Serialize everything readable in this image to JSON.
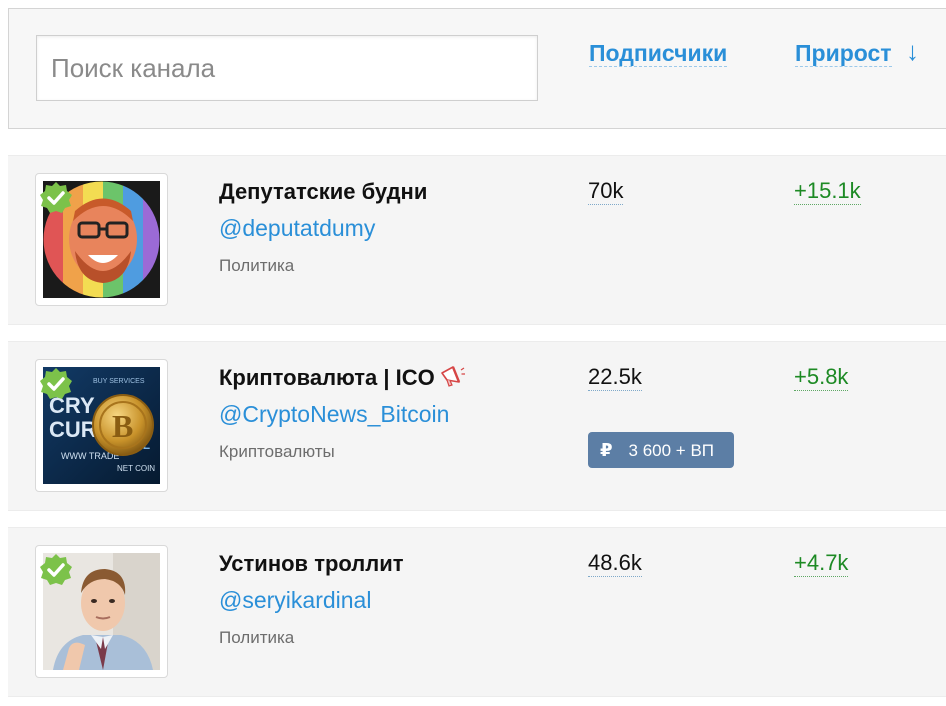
{
  "search": {
    "placeholder": "Поиск канала"
  },
  "columns": {
    "subscribers_label": "Подписчики",
    "growth_label": "Прирост",
    "sort_arrow": "↓"
  },
  "channels": [
    {
      "title": "Депутатские будни",
      "handle": "@deputatdumy",
      "category": "Политика",
      "subscribers": "70k",
      "growth": "+15.1k",
      "verified": true,
      "avatar_icon": "cartoon-portrait-rainbow-avatar"
    },
    {
      "title": "Криптовалюта | ICO",
      "handle": "@CryptoNews_Bitcoin",
      "category": "Криптовалюты",
      "subscribers": "22.5k",
      "growth": "+5.8k",
      "verified": true,
      "avatar_icon": "bitcoin-coin-avatar",
      "title_icon": "megaphone-icon",
      "price": {
        "currency_symbol": "₽",
        "text": "3 600 + ВП"
      }
    },
    {
      "title": "Устинов троллит",
      "handle": "@seryikardinal",
      "category": "Политика",
      "subscribers": "48.6k",
      "growth": "+4.7k",
      "verified": true,
      "avatar_icon": "man-portrait-avatar"
    }
  ],
  "colors": {
    "link_blue": "#2a8fd8",
    "growth_green": "#1d8a24",
    "badge_blue": "#5c7ea5",
    "verified_green": "#7cc24a"
  }
}
